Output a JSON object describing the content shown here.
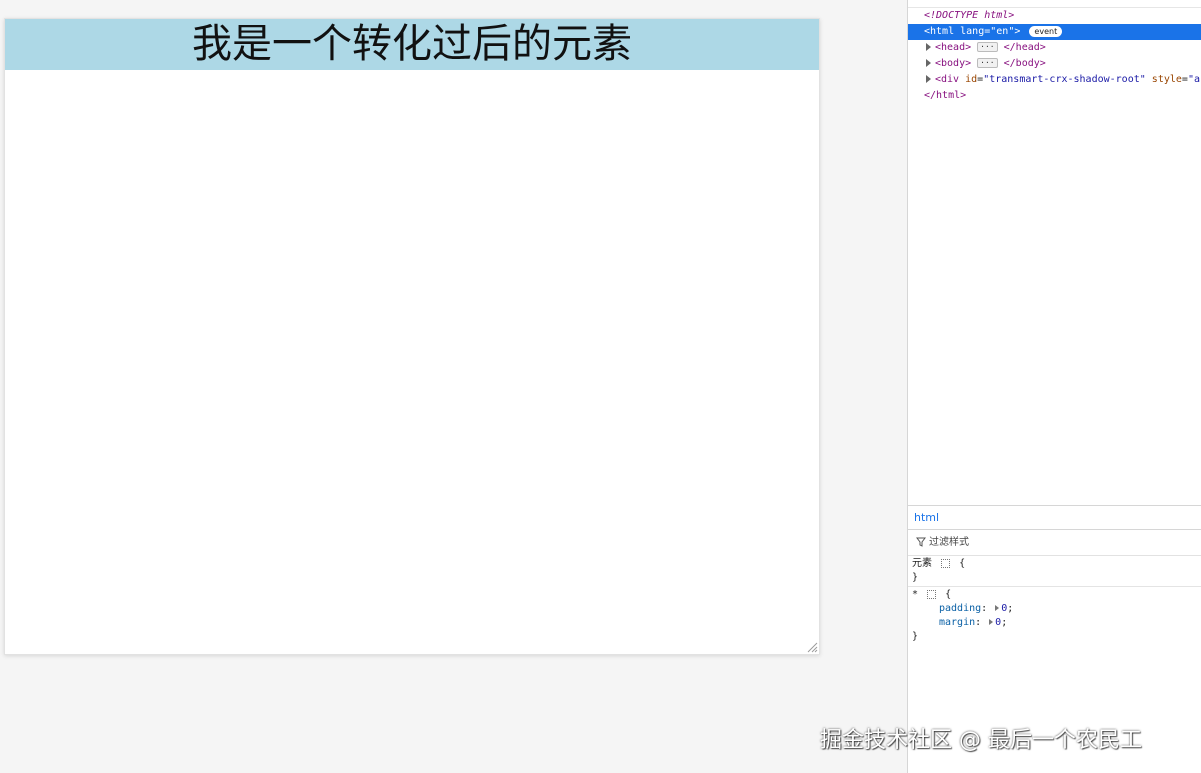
{
  "preview": {
    "transformed_text": "我是一个转化过后的元素",
    "highlight_color": "#add8e6"
  },
  "watermark": "掘金技术社区 @ 最后一个农民工",
  "devtools": {
    "dom": {
      "doctype": "<!DOCTYPE html>",
      "html_tag_open": "<html",
      "html_attr_name": "lang",
      "html_attr_value": "\"en\"",
      "html_tag_close": ">",
      "event_badge": "event",
      "head_open": "<head>",
      "head_close": "</head>",
      "body_open": "<body>",
      "body_close": "</body>",
      "div_open": "<div",
      "div_attr_id_name": "id",
      "div_attr_id_value": "\"transmart-crx-shadow-root\"",
      "div_attr_style_name": "style",
      "div_attr_style_value": "\"a",
      "html_end": "</html>",
      "ellipsis": "···"
    },
    "breadcrumb": "html",
    "filter_placeholder": "过滤样式",
    "styles": {
      "element_selector": "元素",
      "open_brace": "{",
      "close_brace": "}",
      "universal_selector": "*",
      "props": [
        {
          "name": "padding",
          "value": "0"
        },
        {
          "name": "margin",
          "value": "0"
        }
      ]
    },
    "selection_color": "#1a73e8"
  }
}
